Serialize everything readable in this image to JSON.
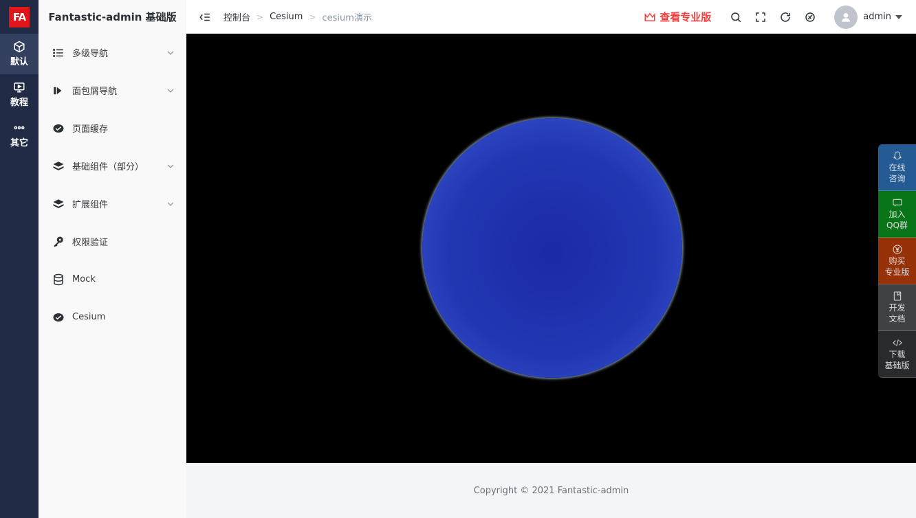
{
  "rail": {
    "logo": "FA",
    "items": [
      {
        "label": "默认",
        "icon": "cube-icon"
      },
      {
        "label": "教程",
        "icon": "monitor-play-icon"
      },
      {
        "label": "其它",
        "icon": "more-dots-icon"
      }
    ]
  },
  "sidebar": {
    "title": "Fantastic-admin 基础版",
    "items": [
      {
        "label": "多级导航",
        "icon": "list-icon",
        "has_children": true
      },
      {
        "label": "面包屑导航",
        "icon": "forward-icon",
        "has_children": true
      },
      {
        "label": "页面缓存",
        "icon": "check-badge-icon",
        "has_children": false
      },
      {
        "label": "基础组件（部分）",
        "icon": "layers-icon",
        "has_children": true
      },
      {
        "label": "扩展组件",
        "icon": "layers-icon",
        "has_children": true
      },
      {
        "label": "权限验证",
        "icon": "key-icon",
        "has_children": false
      },
      {
        "label": "Mock",
        "icon": "database-icon",
        "has_children": false
      },
      {
        "label": "Cesium",
        "icon": "check-badge-icon",
        "has_children": false
      }
    ]
  },
  "header": {
    "breadcrumb": [
      "控制台",
      "Cesium",
      "cesium演示"
    ],
    "pro_label": "查看专业版",
    "user": "admin"
  },
  "footer": {
    "copyright": "Copyright © 2021 Fantastic-admin"
  },
  "float_buttons": [
    {
      "line1": "在线",
      "line2": "咨询",
      "color": "#2b6cb0",
      "icon": "qq-icon"
    },
    {
      "line1": "加入",
      "line2": "QQ群",
      "color": "#0b8a1e",
      "icon": "chat-icon"
    },
    {
      "line1": "购买",
      "line2": "专业版",
      "color": "#b23a0a",
      "icon": "yen-icon"
    },
    {
      "line1": "开发",
      "line2": "文档",
      "color": "#4a4d52",
      "icon": "book-icon"
    },
    {
      "line1": "下载",
      "line2": "基础版",
      "color": "#2f3237",
      "icon": "code-icon"
    }
  ],
  "colors": {
    "rail_bg": "#222b45",
    "accent_red": "#f5403f",
    "viewer_bg": "#000000",
    "globe_blue": "#2236b3"
  }
}
